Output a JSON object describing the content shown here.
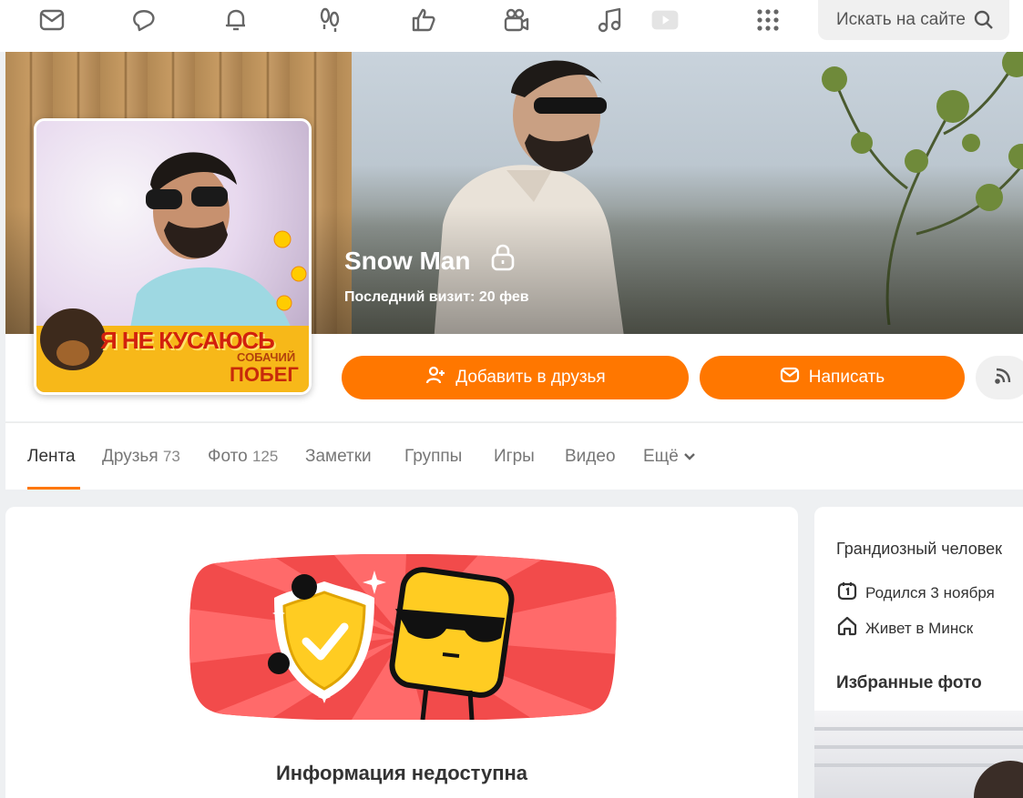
{
  "topbar": {
    "icons": [
      "messages-icon",
      "discussions-icon",
      "notifications-icon",
      "guests-icon",
      "likes-icon",
      "video-icon",
      "music-icon",
      "play-icon",
      "apps-grid-icon"
    ],
    "search": {
      "placeholder": "Искать на сайте"
    }
  },
  "profile": {
    "name": "Snow Man",
    "last_visit": "Последний визит: 20 фев",
    "avatar_overlay": {
      "line1": "Я НЕ КУСАЮСЬ",
      "line2": "СОБАЧИЙ",
      "line3": "ПОБЕГ"
    }
  },
  "actions": {
    "add_friend": "Добавить в друзья",
    "message": "Написать"
  },
  "tabs": [
    {
      "label": "Лента",
      "count": ""
    },
    {
      "label": "Друзья",
      "count": "73"
    },
    {
      "label": "Фото",
      "count": "125"
    },
    {
      "label": "Заметки",
      "count": ""
    },
    {
      "label": "Группы",
      "count": ""
    },
    {
      "label": "Игры",
      "count": ""
    },
    {
      "label": "Видео",
      "count": ""
    },
    {
      "label": "Ещё",
      "count": ""
    }
  ],
  "main": {
    "unavailable_title": "Информация недоступна"
  },
  "sidebar": {
    "status": "Грандиозный человек",
    "born": "Родился 3 ноября",
    "lives": "Живет в Минск",
    "favorite_photos": "Избранные фото"
  },
  "colors": {
    "accent": "#ff7700",
    "banner_red": "#f24b4b",
    "banner_yellow": "#ffcc22"
  }
}
